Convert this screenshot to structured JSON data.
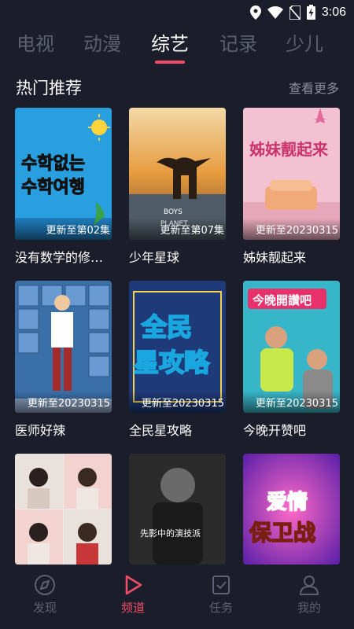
{
  "status_bar": {
    "time": "3:06"
  },
  "tabs": [
    {
      "label": "电视",
      "active": false
    },
    {
      "label": "动漫",
      "active": false
    },
    {
      "label": "综艺",
      "active": true
    },
    {
      "label": "记录",
      "active": false
    },
    {
      "label": "少儿",
      "active": false
    }
  ],
  "section": {
    "title": "热门推荐",
    "more": "查看更多"
  },
  "cards": [
    {
      "title": "没有数学的修…",
      "badge": "更新至第02集",
      "poster_text": "수학없는 수학여행",
      "color": "#2a9fe0"
    },
    {
      "title": "少年星球",
      "badge": "更新至第07集",
      "poster_text": "BOYS PLANET",
      "color": "#e49a3c"
    },
    {
      "title": "姊妹靓起来",
      "badge": "更新至20230315",
      "poster_text": "姊妹靓起来",
      "color": "#f0b6c8"
    },
    {
      "title": "医师好辣",
      "badge": "更新至20230315",
      "poster_text": "",
      "color": "#3a6fa8"
    },
    {
      "title": "全民星攻略",
      "badge": "更新至20230315",
      "poster_text": "全民星攻略",
      "color": "#1f3a78"
    },
    {
      "title": "今晚开赞吧",
      "badge": "更新至20230315",
      "poster_text": "今晚開讚吧",
      "color": "#38b6c9"
    },
    {
      "title": "",
      "badge": "",
      "poster_text": "",
      "color": "#e8e4e0"
    },
    {
      "title": "",
      "badge": "",
      "poster_text": "先影中的演技派",
      "color": "#2b2b2b"
    },
    {
      "title": "",
      "badge": "",
      "poster_text": "爱情保卫战",
      "color": "#7a2ab8"
    }
  ],
  "bottom_nav": [
    {
      "label": "发现",
      "icon": "compass-icon",
      "active": false
    },
    {
      "label": "频道",
      "icon": "play-icon",
      "active": true
    },
    {
      "label": "任务",
      "icon": "task-icon",
      "active": false
    },
    {
      "label": "我的",
      "icon": "user-icon",
      "active": false
    }
  ]
}
